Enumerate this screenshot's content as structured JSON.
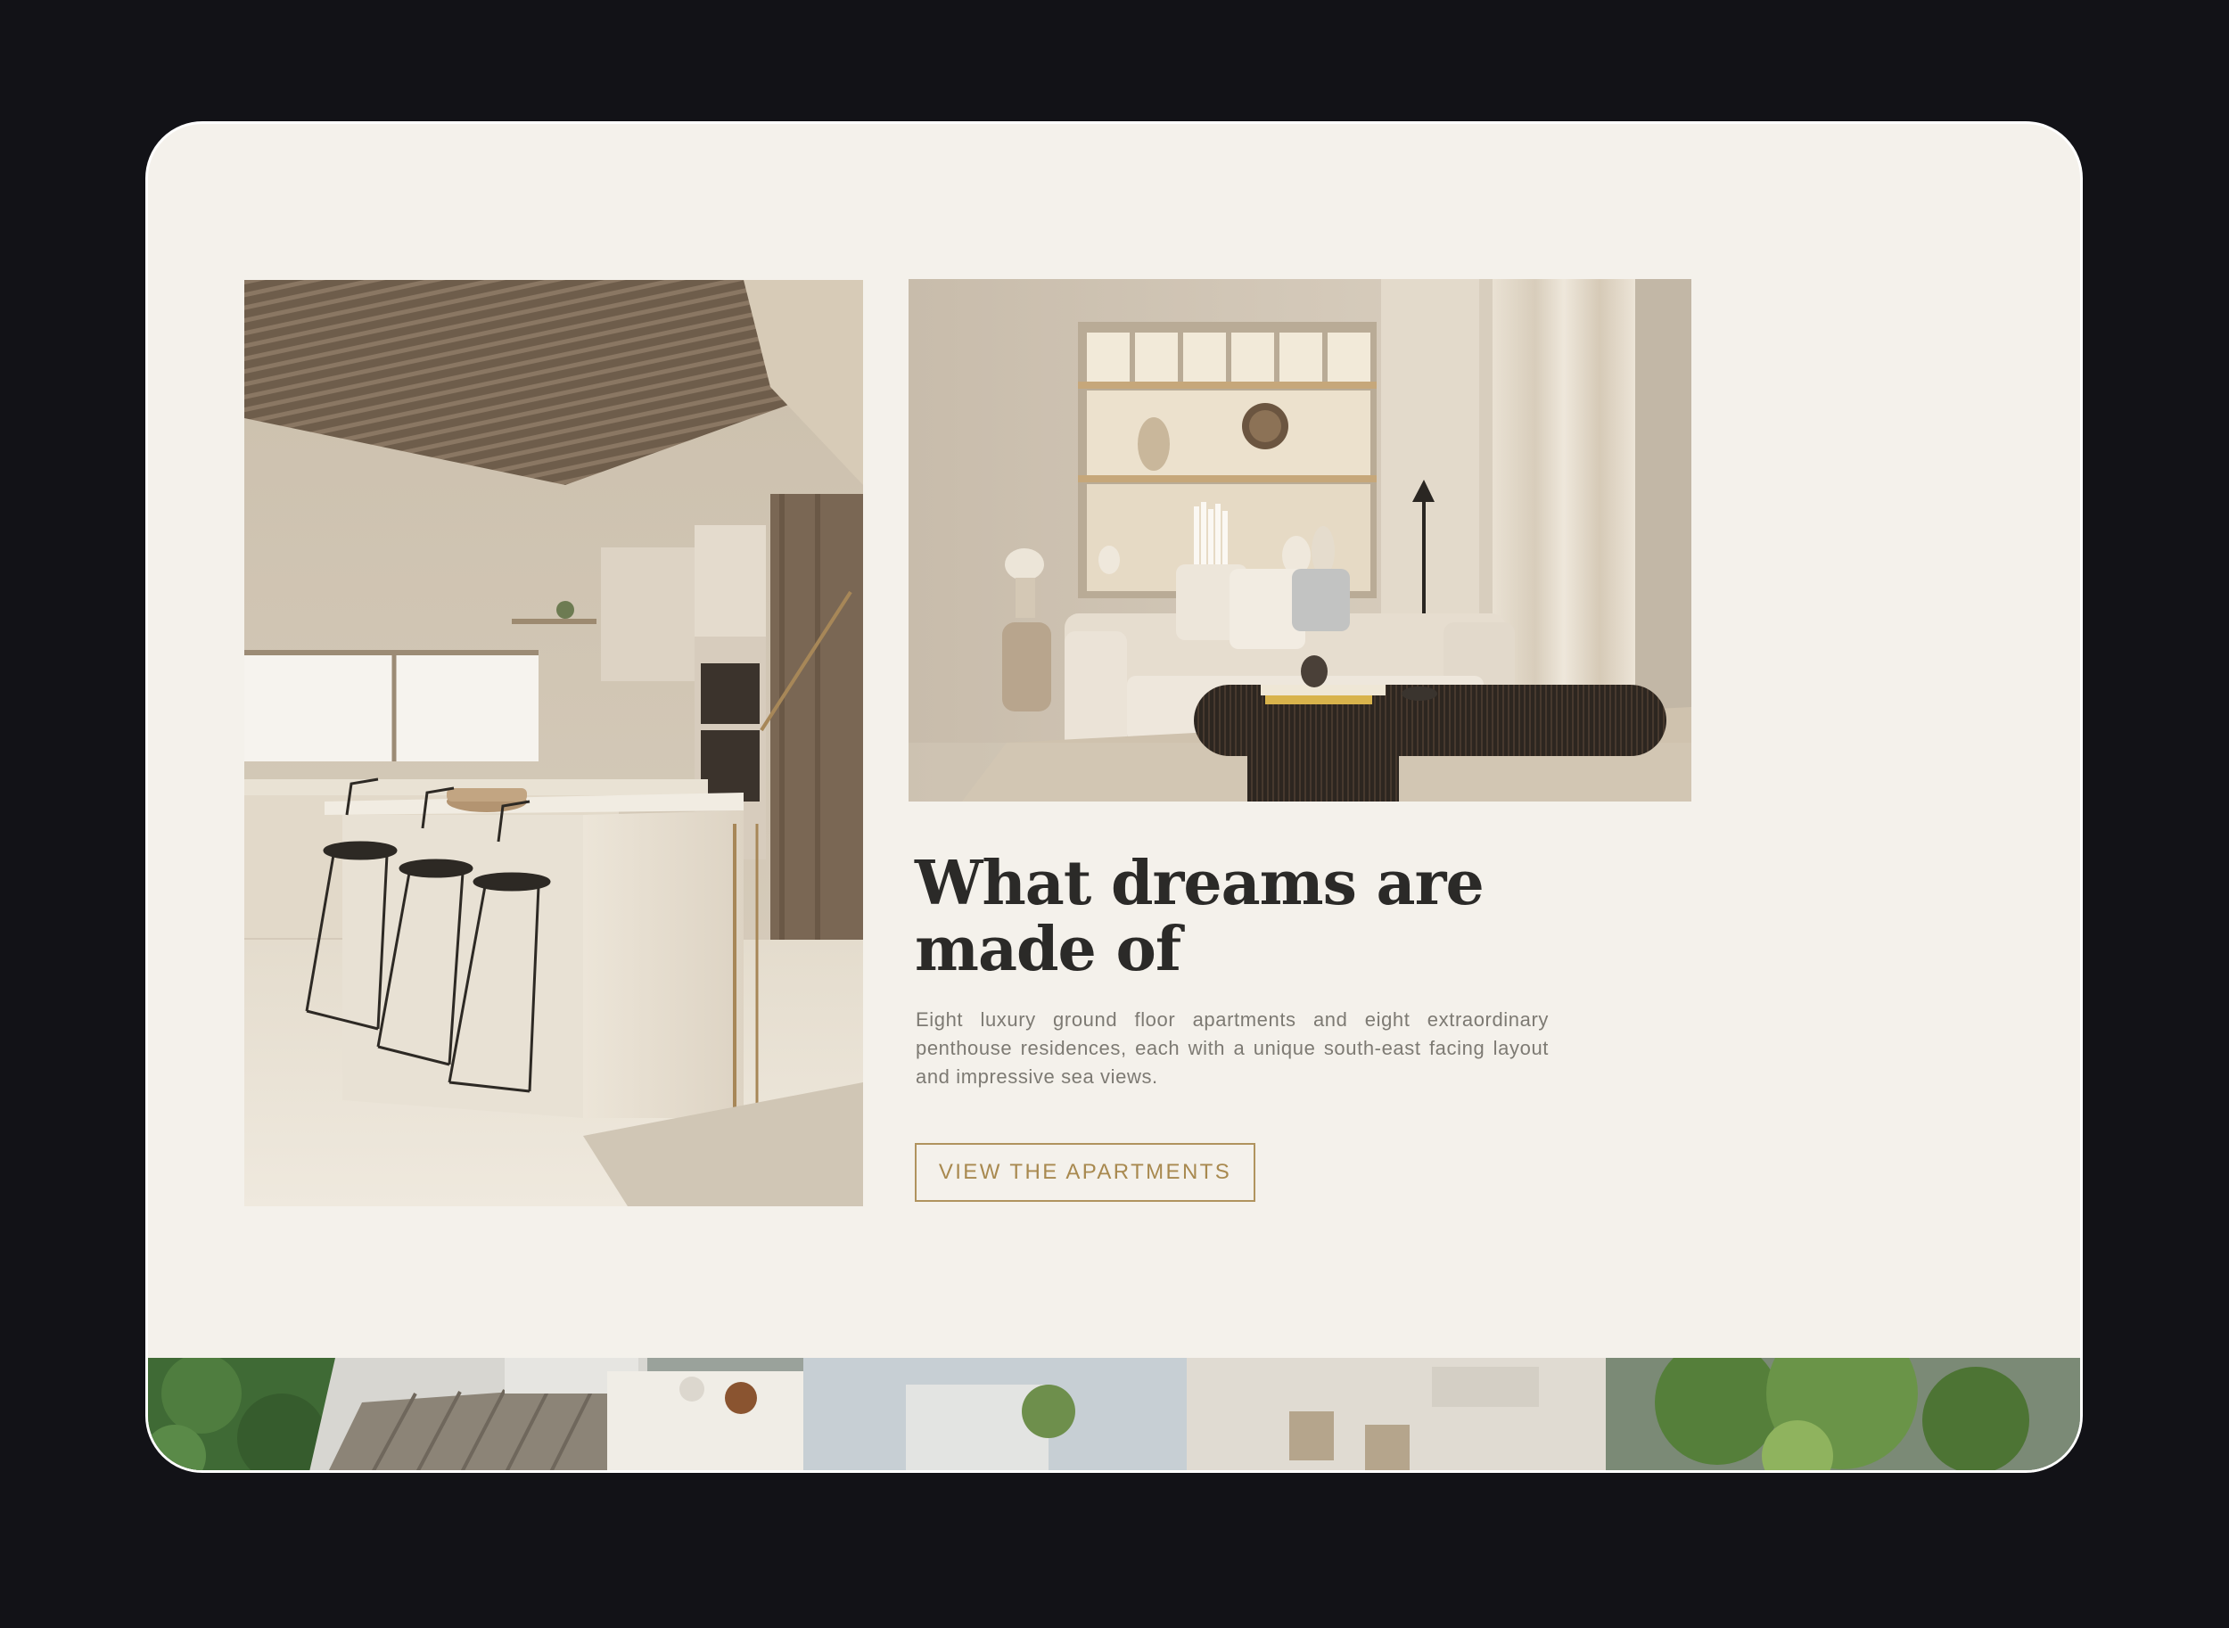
{
  "section": {
    "heading_line1": "What dreams are",
    "heading_line2": "made of",
    "description": "Eight luxury ground floor apartments and eight extraordinary penthouse residences, each with a unique south-east facing layout and impressive sea views.",
    "cta_label": "VIEW THE APARTMENTS"
  },
  "colors": {
    "page_background": "#121217",
    "card_background": "#f4f1eb",
    "heading": "#2b2a28",
    "body_text": "#7d7a73",
    "accent_gold": "#b0935e"
  },
  "images": {
    "kitchen": "kitchen-interior-image",
    "living": "living-room-image",
    "terrace": "terrace-aerial-image"
  }
}
